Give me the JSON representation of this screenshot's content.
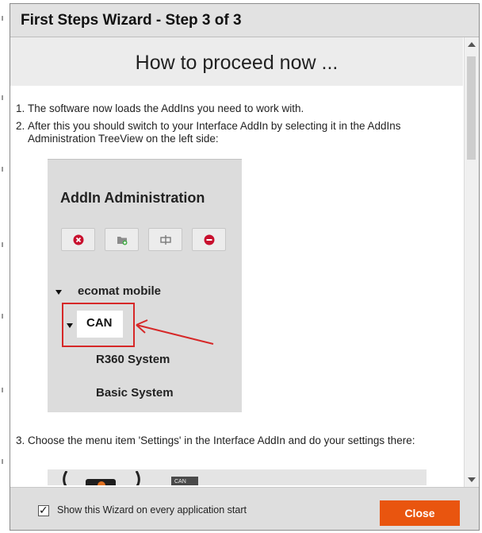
{
  "window": {
    "title": "First Steps Wizard - Step 3 of 3"
  },
  "header": {
    "heading": "How to proceed now ..."
  },
  "steps": [
    {
      "number": "1.",
      "text": "The software now loads the AddIns you need to work with."
    },
    {
      "number": "2.",
      "text": "After this you should switch to your Interface AddIn by selecting it in the AddIns",
      "text2": "Administration TreeView on the left side:"
    },
    {
      "number": "3.",
      "text": "Choose the menu item 'Settings' in the Interface AddIn and do your settings there:"
    }
  ],
  "illustration": {
    "title": "AddIn Administration",
    "toolbar_icons": [
      "remove-icon",
      "add-folder-icon",
      "configure-icon",
      "minus-icon"
    ],
    "tree": {
      "root": "ecomat mobile",
      "selected": "CAN",
      "children": [
        "R360 System",
        "Basic System"
      ]
    },
    "highlight_color": "#d62828"
  },
  "illustration2": {
    "tag": "CAN"
  },
  "footer": {
    "checkbox_label": "Show this Wizard on every application start",
    "checkbox_checked": true,
    "close_label": "Close"
  },
  "colors": {
    "accent": "#e9550f"
  }
}
